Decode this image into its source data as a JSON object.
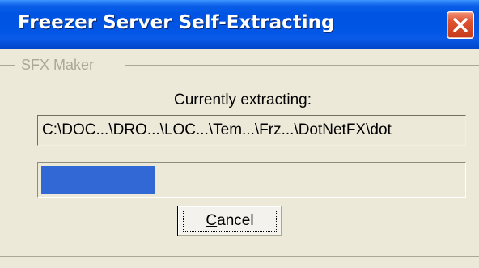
{
  "window": {
    "title": "Freezer Server Self-Extracting"
  },
  "group": {
    "label": "SFX Maker"
  },
  "extraction": {
    "status_label": "Currently extracting:",
    "current_path": "C:\\DOC...\\DRO...\\LOC...\\Tem...\\Frz...\\DotNetFX\\dot",
    "progress_fraction": 0.27
  },
  "buttons": {
    "cancel_mnemonic": "C",
    "cancel_rest": "ancel"
  },
  "colors": {
    "titlebar": "#0054e3",
    "progress_fill": "#3168d5",
    "close_button": "#e1532e"
  },
  "icons": {
    "close": "close-icon"
  }
}
